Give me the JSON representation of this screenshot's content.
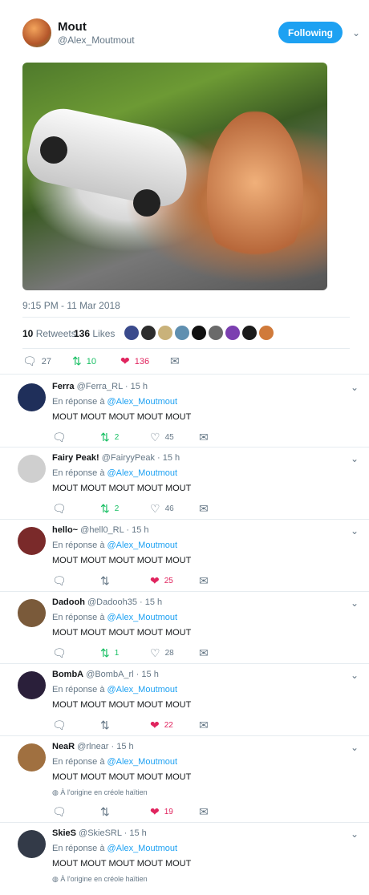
{
  "tweet": {
    "name": "Mout",
    "handle": "@Alex_Moutmout",
    "follow_label": "Following",
    "timestamp": "9:15 PM - 11 Mar 2018",
    "retweets_count": "10",
    "retweets_label": "Retweets",
    "likes_count": "136",
    "likes_label": "Likes",
    "actions": {
      "replies": "27",
      "retweets": "10",
      "likes": "136"
    }
  },
  "likers": [
    "#3a4a8c",
    "#2c2c2c",
    "#c9b27a",
    "#5f8fb0",
    "#111",
    "#6a6a6a",
    "#7b3fb0",
    "#1b1b1b",
    "#d07a3a"
  ],
  "replies": [
    {
      "name": "Ferra",
      "handle": "@Ferra_RL",
      "time": "· 15 h",
      "prefix": "En réponse à",
      "to": "@Alex_Moutmout",
      "text": "MOUT MOUT MOUT MOUT MOUT",
      "retweets": "2",
      "likes": "45",
      "liked": false,
      "retweeted": true,
      "avatar": "#1f2f5a",
      "origin": ""
    },
    {
      "name": "Fairy Peak!",
      "handle": "@FairyyPeak",
      "time": "· 15 h",
      "prefix": "En réponse à",
      "to": "@Alex_Moutmout",
      "text": "MOUT MOUT MOUT MOUT MOUT",
      "retweets": "2",
      "likes": "46",
      "liked": false,
      "retweeted": true,
      "avatar": "#cfcfcf",
      "origin": ""
    },
    {
      "name": "hello~",
      "handle": "@hell0_RL",
      "time": "· 15 h",
      "prefix": "En réponse à",
      "to": "@Alex_Moutmout",
      "text": "MOUT MOUT MOUT MOUT MOUT",
      "retweets": "",
      "likes": "25",
      "liked": true,
      "retweeted": false,
      "avatar": "#7a2a2a",
      "origin": ""
    },
    {
      "name": "Dadooh",
      "handle": "@Dadooh35",
      "time": "· 15 h",
      "prefix": "En réponse à",
      "to": "@Alex_Moutmout",
      "text": "MOUT MOUT MOUT MOUT MOUT",
      "retweets": "1",
      "likes": "28",
      "liked": false,
      "retweeted": true,
      "avatar": "#7a5a3a",
      "origin": ""
    },
    {
      "name": "BombA",
      "handle": "@BombA_rl",
      "time": "· 15 h",
      "prefix": "En réponse à",
      "to": "@Alex_Moutmout",
      "text": "MOUT MOUT MOUT MOUT MOUT",
      "retweets": "",
      "likes": "22",
      "liked": true,
      "retweeted": false,
      "avatar": "#2a1f3a",
      "origin": ""
    },
    {
      "name": "NeaR",
      "handle": "@rlnear",
      "time": "· 15 h",
      "prefix": "En réponse à",
      "to": "@Alex_Moutmout",
      "text": "MOUT MOUT MOUT MOUT MOUT",
      "retweets": "",
      "likes": "19",
      "liked": true,
      "retweeted": false,
      "avatar": "#a07040",
      "origin": "À l'origine en créole haïtien"
    },
    {
      "name": "SkieS",
      "handle": "@SkieSRL",
      "time": "· 15 h",
      "prefix": "En réponse à",
      "to": "@Alex_Moutmout",
      "text": "MOUT MOUT MOUT MOUT MOUT",
      "retweets": "",
      "likes": "",
      "liked": false,
      "retweeted": false,
      "avatar": "#333a48",
      "origin": "À l'origine en créole haïtien"
    }
  ],
  "icons": {
    "reply": "reply-icon",
    "retweet": "retweet-icon",
    "like": "heart-icon",
    "dm": "mail-icon",
    "chevron": "chevron-down-icon",
    "globe": "globe-icon"
  }
}
